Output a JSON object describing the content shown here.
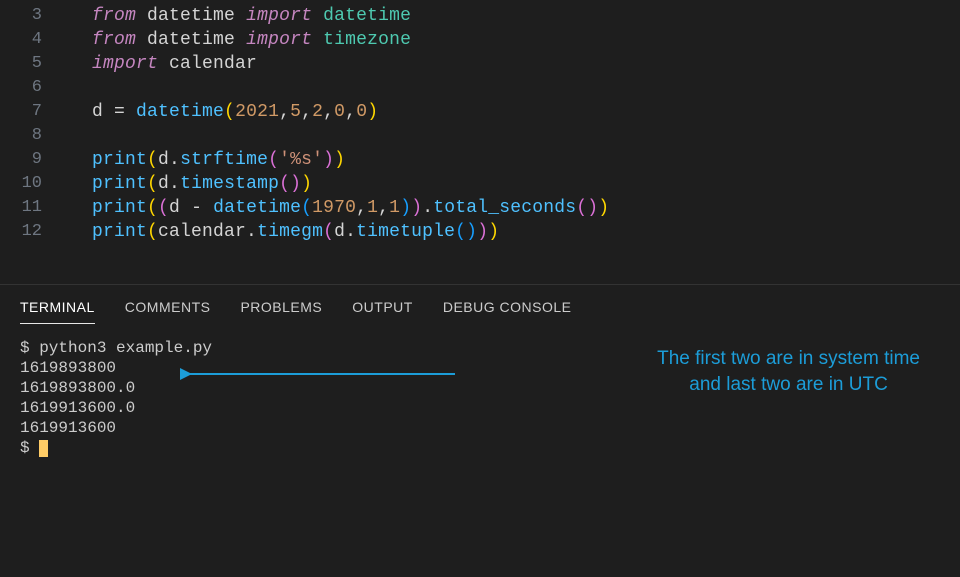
{
  "editor": {
    "lines": [
      {
        "n": "3",
        "tokens": [
          [
            "kw",
            "from"
          ],
          [
            "op",
            " "
          ],
          [
            "mod",
            "datetime"
          ],
          [
            "op",
            " "
          ],
          [
            "kw",
            "import"
          ],
          [
            "op",
            " "
          ],
          [
            "cls",
            "datetime"
          ]
        ]
      },
      {
        "n": "4",
        "tokens": [
          [
            "kw",
            "from"
          ],
          [
            "op",
            " "
          ],
          [
            "mod",
            "datetime"
          ],
          [
            "op",
            " "
          ],
          [
            "kw",
            "import"
          ],
          [
            "op",
            " "
          ],
          [
            "cls",
            "timezone"
          ]
        ]
      },
      {
        "n": "5",
        "tokens": [
          [
            "kw",
            "import"
          ],
          [
            "op",
            " "
          ],
          [
            "mod",
            "calendar"
          ]
        ]
      },
      {
        "n": "6",
        "tokens": []
      },
      {
        "n": "7",
        "tokens": [
          [
            "var",
            "d "
          ],
          [
            "op",
            "= "
          ],
          [
            "fn",
            "datetime"
          ],
          [
            "paren",
            "("
          ],
          [
            "num",
            "2021"
          ],
          [
            "op",
            ","
          ],
          [
            "num",
            "5"
          ],
          [
            "op",
            ","
          ],
          [
            "num",
            "2"
          ],
          [
            "op",
            ","
          ],
          [
            "num",
            "0"
          ],
          [
            "op",
            ","
          ],
          [
            "num",
            "0"
          ],
          [
            "paren",
            ")"
          ]
        ]
      },
      {
        "n": "8",
        "tokens": []
      },
      {
        "n": "9",
        "tokens": [
          [
            "fn",
            "print"
          ],
          [
            "paren",
            "("
          ],
          [
            "var",
            "d"
          ],
          [
            "op",
            "."
          ],
          [
            "fn",
            "strftime"
          ],
          [
            "paren2",
            "("
          ],
          [
            "str",
            "'%s'"
          ],
          [
            "paren2",
            ")"
          ],
          [
            "paren",
            ")"
          ]
        ]
      },
      {
        "n": "10",
        "tokens": [
          [
            "fn",
            "print"
          ],
          [
            "paren",
            "("
          ],
          [
            "var",
            "d"
          ],
          [
            "op",
            "."
          ],
          [
            "fn",
            "timestamp"
          ],
          [
            "paren2",
            "("
          ],
          [
            "paren2",
            ")"
          ],
          [
            "paren",
            ")"
          ]
        ]
      },
      {
        "n": "11",
        "tokens": [
          [
            "fn",
            "print"
          ],
          [
            "paren",
            "("
          ],
          [
            "paren2",
            "("
          ],
          [
            "var",
            "d "
          ],
          [
            "op",
            "- "
          ],
          [
            "fn",
            "datetime"
          ],
          [
            "paren3",
            "("
          ],
          [
            "num",
            "1970"
          ],
          [
            "op",
            ","
          ],
          [
            "num",
            "1"
          ],
          [
            "op",
            ","
          ],
          [
            "num",
            "1"
          ],
          [
            "paren3",
            ")"
          ],
          [
            "paren2",
            ")"
          ],
          [
            "op",
            "."
          ],
          [
            "fn",
            "total_seconds"
          ],
          [
            "paren2",
            "("
          ],
          [
            "paren2",
            ")"
          ],
          [
            "paren",
            ")"
          ]
        ]
      },
      {
        "n": "12",
        "tokens": [
          [
            "fn",
            "print"
          ],
          [
            "paren",
            "("
          ],
          [
            "var",
            "calendar"
          ],
          [
            "op",
            "."
          ],
          [
            "fn",
            "timegm"
          ],
          [
            "paren2",
            "("
          ],
          [
            "var",
            "d"
          ],
          [
            "op",
            "."
          ],
          [
            "fn",
            "timetuple"
          ],
          [
            "paren3",
            "("
          ],
          [
            "paren3",
            ")"
          ],
          [
            "paren2",
            ")"
          ],
          [
            "paren",
            ")"
          ]
        ]
      }
    ]
  },
  "panel": {
    "tabs": [
      {
        "label": "TERMINAL",
        "active": true
      },
      {
        "label": "COMMENTS",
        "active": false
      },
      {
        "label": "PROBLEMS",
        "active": false
      },
      {
        "label": "OUTPUT",
        "active": false
      },
      {
        "label": "DEBUG CONSOLE",
        "active": false
      }
    ]
  },
  "terminal": {
    "lines": [
      "$ python3 example.py",
      "1619893800",
      "1619893800.0",
      "1619913600.0",
      "1619913600",
      "$ "
    ],
    "annotation_line1": "The first two are in system time",
    "annotation_line2": "and last two are in UTC"
  }
}
